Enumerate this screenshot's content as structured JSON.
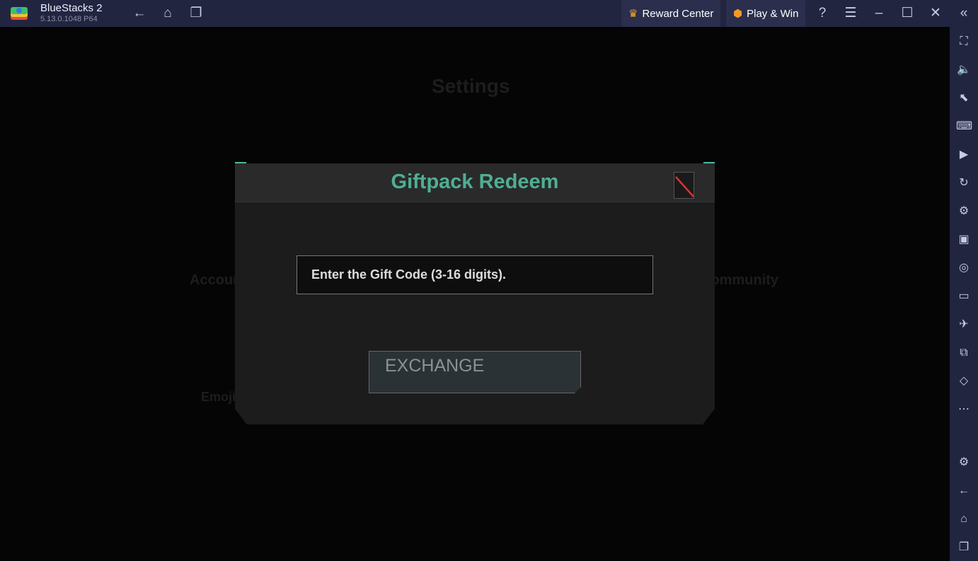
{
  "app": {
    "title": "BlueStacks 2",
    "version": "5.13.0.1048  P64"
  },
  "topbar": {
    "reward_center": "Reward Center",
    "play_win": "Play & Win"
  },
  "background": {
    "settings_title": "Settings",
    "account": "Account",
    "community": "Community",
    "emoji": "Emoji"
  },
  "dialog": {
    "title": "Giftpack Redeem",
    "input_placeholder": "Enter the Gift Code (3-16 digits).",
    "exchange": "EXCHANGE"
  },
  "colors": {
    "accent": "#4fae94",
    "topbar": "#222540"
  }
}
